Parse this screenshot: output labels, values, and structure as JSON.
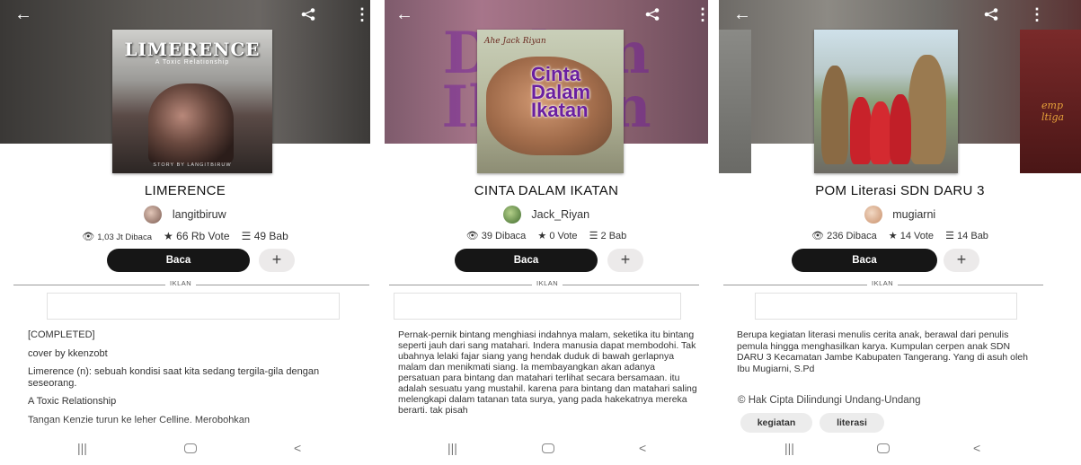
{
  "icons": {
    "back": "arrow-left-icon",
    "share": "share-icon",
    "more": "more-vert-icon",
    "views": "eye-icon",
    "votes": "star-icon",
    "chapters": "list-icon",
    "add": "plus-icon",
    "copyright": "copyright-icon"
  },
  "common": {
    "read_label": "Baca",
    "add_label": "+",
    "ad_label": "IKLAN",
    "back_glyph": "←",
    "more_glyph": "⋮",
    "nav_recent": "|||",
    "nav_back": "<"
  },
  "screens": [
    {
      "cover": {
        "title": "LIMERENCE",
        "subtitle": "A Toxic Relationship",
        "byline": "STORY BY LANGITBIRUW"
      },
      "book_title": "LIMERENCE",
      "author": "langitbiruw",
      "stats": {
        "views": "1,03 Jt Dibaca",
        "votes": "66 Rb Vote",
        "chapters": "49 Bab"
      },
      "description": [
        "[COMPLETED]",
        "cover by kkenzobt",
        "Limerence (n): sebuah kondisi saat kita sedang tergila-gila dengan seseorang.",
        "A Toxic Relationship",
        "Tangan Kenzie turun ke leher Celline. Merobohkan"
      ]
    },
    {
      "cover": {
        "author_line": "Ahe Jack Riyan",
        "title_lines": [
          "Cinta",
          "Dalam",
          "Ikatan"
        ]
      },
      "hero_text": "Dalam Ikatan",
      "book_title": "CINTA DALAM IKATAN",
      "author": "Jack_Riyan",
      "stats": {
        "views": "39 Dibaca",
        "votes": "0 Vote",
        "chapters": "2 Bab"
      },
      "description": [
        "Pernak-pernik bintang menghiasi indahnya malam, seketika itu bintang seperti jauh dari sang matahari. Indera manusia dapat membodohi. Tak ubahnya lelaki fajar siang yang hendak duduk di bawah gerlapnya malam dan menikmati siang. Ia membayangkan akan adanya persatuan para bintang dan matahari terlihat secara bersamaan. itu adalah sesuatu yang mustahil. karena para bintang dan matahari saling melengkapi dalam tatanan tata surya, yang pada hakekatnya mereka berarti. tak pisah"
      ]
    },
    {
      "side_cover_text": "emp ltiga",
      "book_title": "POM Literasi SDN DARU 3",
      "author": "mugiarni",
      "stats": {
        "views": "236 Dibaca",
        "votes": "14 Vote",
        "chapters": "14 Bab"
      },
      "description": [
        "Berupa kegiatan literasi menulis cerita anak, berawal dari penulis pemula hingga menghasilkan karya. Kumpulan cerpen anak SDN DARU 3 Kecamatan Jambe Kabupaten Tangerang. Yang di asuh oleh Ibu Mugiarni, S.Pd"
      ],
      "copyright": "Hak Cipta Dilindungi Undang-Undang",
      "tags": [
        "kegiatan",
        "literasi"
      ]
    }
  ]
}
